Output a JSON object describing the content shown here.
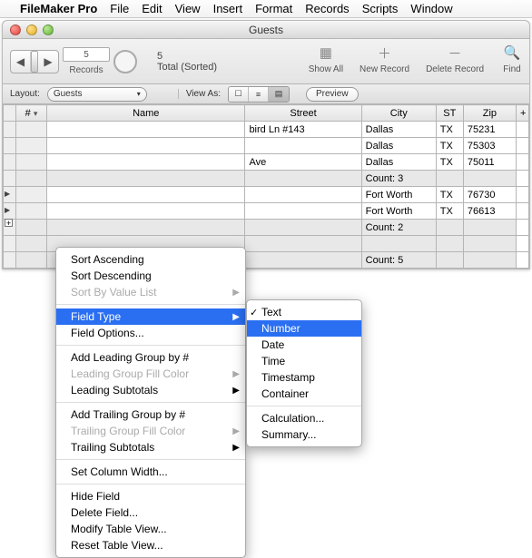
{
  "menubar": {
    "app": "FileMaker Pro",
    "items": [
      "File",
      "Edit",
      "View",
      "Insert",
      "Format",
      "Records",
      "Scripts",
      "Window"
    ]
  },
  "window": {
    "title": "Guests"
  },
  "toolbar": {
    "record_field": "5",
    "record_count": "5",
    "record_status": "Total (Sorted)",
    "records_label": "Records",
    "showall_label": "Show All",
    "newrec_label": "New Record",
    "delrec_label": "Delete Record",
    "find_label": "Find"
  },
  "layoutbar": {
    "layout_label": "Layout:",
    "layout_value": "Guests",
    "viewas_label": "View As:",
    "preview_label": "Preview"
  },
  "table": {
    "headers": {
      "num": "#",
      "name": "Name",
      "street": "Street",
      "city": "City",
      "st": "ST",
      "zip": "Zip",
      "plus": "+"
    },
    "rows": [
      {
        "street": "bird Ln #143",
        "city": "Dallas",
        "st": "TX",
        "zip": "75231"
      },
      {
        "street": "",
        "city": "Dallas",
        "st": "TX",
        "zip": "75303"
      },
      {
        "street": "Ave",
        "city": "Dallas",
        "st": "TX",
        "zip": "75011"
      }
    ],
    "summary1": "Count: 3",
    "rows2": [
      {
        "city": "Fort Worth",
        "st": "TX",
        "zip": "76730"
      },
      {
        "city": "Fort Worth",
        "st": "TX",
        "zip": "76613"
      }
    ],
    "summary2": "Count: 2",
    "summary3": "Count: 5"
  },
  "context": {
    "sort_asc": "Sort Ascending",
    "sort_desc": "Sort Descending",
    "sort_vl": "Sort By Value List",
    "field_type": "Field Type",
    "field_opts": "Field Options...",
    "add_lead": "Add Leading Group by #",
    "lead_fill": "Leading Group Fill Color",
    "lead_sub": "Leading Subtotals",
    "add_trail": "Add Trailing Group by #",
    "trail_fill": "Trailing Group Fill Color",
    "trail_sub": "Trailing Subtotals",
    "set_col": "Set Column Width...",
    "hide": "Hide Field",
    "delete": "Delete Field...",
    "modify": "Modify Table View...",
    "reset": "Reset Table View..."
  },
  "submenu": {
    "text": "Text",
    "number": "Number",
    "date": "Date",
    "time": "Time",
    "timestamp": "Timestamp",
    "container": "Container",
    "calc": "Calculation...",
    "summary": "Summary..."
  }
}
